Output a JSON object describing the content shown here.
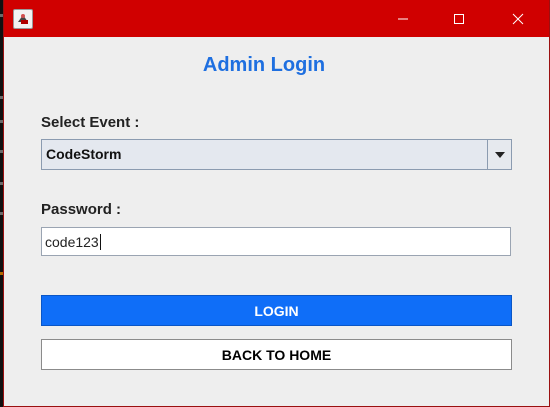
{
  "window": {
    "title_bar_color": "#d00000",
    "icon": "java-app-icon",
    "controls": {
      "minimize_icon": "minimize-icon",
      "maximize_icon": "maximize-icon",
      "close_icon": "close-icon"
    }
  },
  "form": {
    "heading": "Admin Login",
    "event_label": "Select Event :",
    "event_selected": "CodeStorm",
    "password_label": "Password :",
    "password_value": "code123"
  },
  "buttons": {
    "login": "LOGIN",
    "home": "BACK TO HOME"
  },
  "colors": {
    "accent": "#0f6ef8",
    "heading": "#1e6fe0"
  }
}
